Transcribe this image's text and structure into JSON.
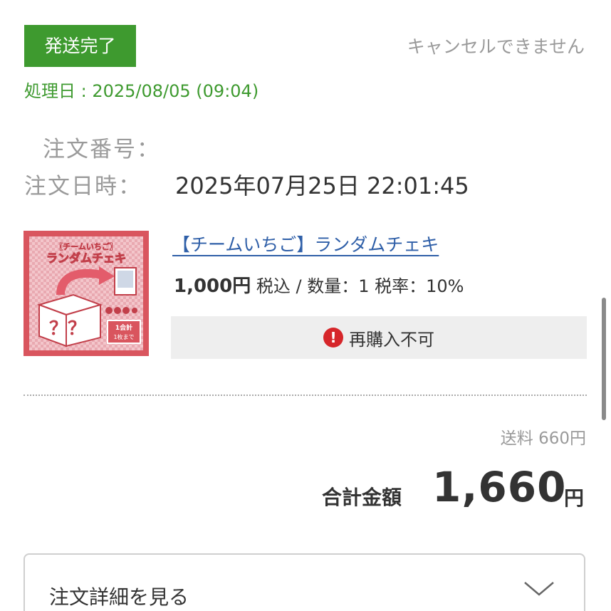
{
  "status": {
    "badge_label": "発送完了",
    "cancel_note": "キャンセルできません",
    "processed_date": "処理日 : 2025/08/05 (09:04)",
    "badge_color": "#3e9a2f"
  },
  "order": {
    "number_label": "注文番号：",
    "date_label": "注文日時：",
    "date_value": "2025年07月25日 22:01:45"
  },
  "product": {
    "title": "【チームいちご】ランダムチェキ",
    "price": "1,000円",
    "price_details": " 税込 / 数量：1 税率：10%",
    "rebuy_label": "再購入不可",
    "rebuy_icon": "alert-icon",
    "thumbnail": {
      "heading_small": "【チームいちご】",
      "heading_large": "ランダムチェキ",
      "question_marks": "？？",
      "tag_line1": "1会計",
      "tag_line2": "1枚まで"
    }
  },
  "summary": {
    "shipping": "送料 660円",
    "total_label": "合計金額",
    "total_value": "1,660",
    "total_unit": "円"
  },
  "details_button": {
    "label": "注文詳細を見る",
    "icon": "chevron-down-icon"
  }
}
